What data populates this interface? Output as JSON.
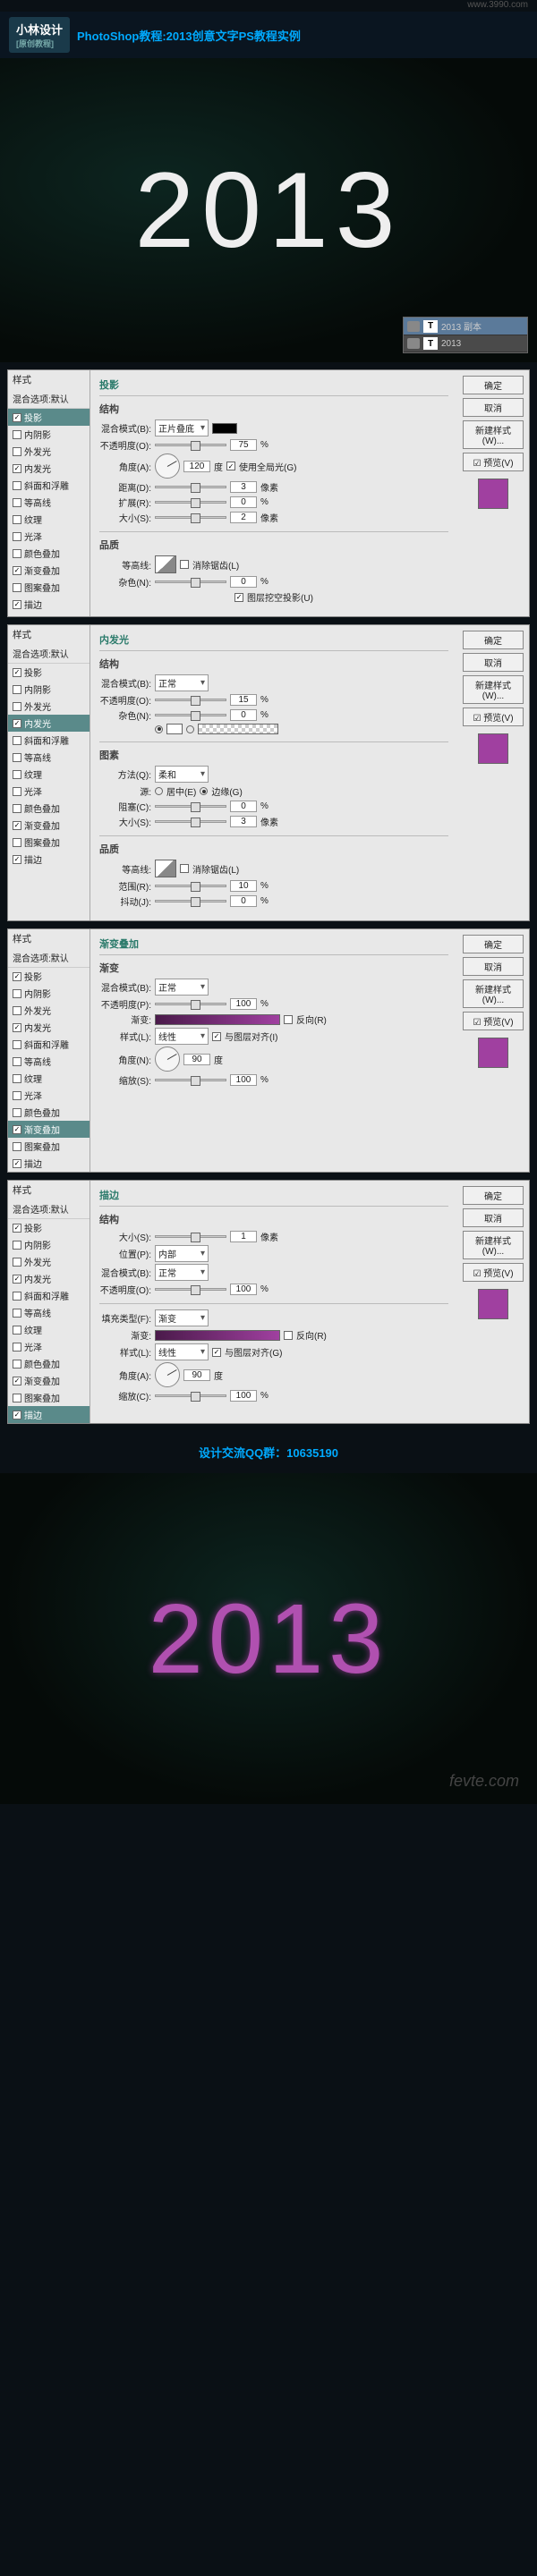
{
  "site_url": "www.3990.com",
  "logo": {
    "main": "小林设计",
    "sub": "[原创教程]"
  },
  "title": "PhotoShop教程:2013创意文字PS教程实例",
  "preview_text": "2013",
  "layers": [
    {
      "name": "2013 副本"
    },
    {
      "name": "2013"
    }
  ],
  "styles_panel": {
    "header": "样式",
    "sub": "混合选项:默认",
    "items": [
      "投影",
      "内阴影",
      "外发光",
      "内发光",
      "斜面和浮雕",
      "等高线",
      "纹理",
      "光泽",
      "颜色叠加",
      "渐变叠加",
      "图案叠加",
      "描边"
    ]
  },
  "buttons": {
    "ok": "确定",
    "cancel": "取消",
    "newstyle": "新建样式(W)...",
    "preview": "☑ 预览(V)"
  },
  "dialog1": {
    "title": "投影",
    "struct": "结构",
    "blend": "混合模式(B):",
    "blend_v": "正片叠底",
    "opacity": "不透明度(O):",
    "opacity_v": "75",
    "pct": "%",
    "angle": "角度(A):",
    "angle_v": "120",
    "deg": "度",
    "global": "使用全局光(G)",
    "distance": "距离(D):",
    "distance_v": "3",
    "px": "像素",
    "spread": "扩展(R):",
    "spread_v": "0",
    "size": "大小(S):",
    "size_v": "2",
    "quality": "品质",
    "contour": "等高线:",
    "anti": "消除锯齿(L)",
    "noise": "杂色(N):",
    "noise_v": "0",
    "knockout": "图层挖空投影(U)"
  },
  "dialog2": {
    "title": "内发光",
    "struct": "结构",
    "blend": "混合模式(B):",
    "blend_v": "正常",
    "opacity": "不透明度(O):",
    "opacity_v": "15",
    "noise": "杂色(N):",
    "noise_v": "0",
    "elements": "图素",
    "method": "方法(Q):",
    "method_v": "柔和",
    "source": "源:",
    "center": "居中(E)",
    "edge": "边缘(G)",
    "choke": "阻塞(C):",
    "choke_v": "0",
    "size": "大小(S):",
    "size_v": "3",
    "quality": "品质",
    "contour": "等高线:",
    "anti": "消除锯齿(L)",
    "range": "范围(R):",
    "range_v": "10",
    "jitter": "抖动(J):",
    "jitter_v": "0"
  },
  "dialog3": {
    "title": "渐变叠加",
    "grad": "渐变",
    "blend": "混合模式(B):",
    "blend_v": "正常",
    "opacity": "不透明度(P):",
    "opacity_v": "100",
    "gradient": "渐变:",
    "reverse": "反向(R)",
    "style": "样式(L):",
    "style_v": "线性",
    "align": "与图层对齐(I)",
    "angle": "角度(N):",
    "angle_v": "90",
    "scale": "缩放(S):",
    "scale_v": "100"
  },
  "dialog4": {
    "title": "描边",
    "struct": "结构",
    "size": "大小(S):",
    "size_v": "1",
    "pos": "位置(P):",
    "pos_v": "内部",
    "blend": "混合模式(B):",
    "blend_v": "正常",
    "opacity": "不透明度(O):",
    "opacity_v": "100",
    "filltype": "填充类型(F):",
    "filltype_v": "渐变",
    "gradient": "渐变:",
    "reverse": "反向(R)",
    "style": "样式(L):",
    "style_v": "线性",
    "align": "与图层对齐(G)",
    "angle": "角度(A):",
    "angle_v": "90",
    "scale": "缩放(C):",
    "scale_v": "100"
  },
  "footer": "设计交流QQ群：10635190",
  "watermark": "fevte.com"
}
